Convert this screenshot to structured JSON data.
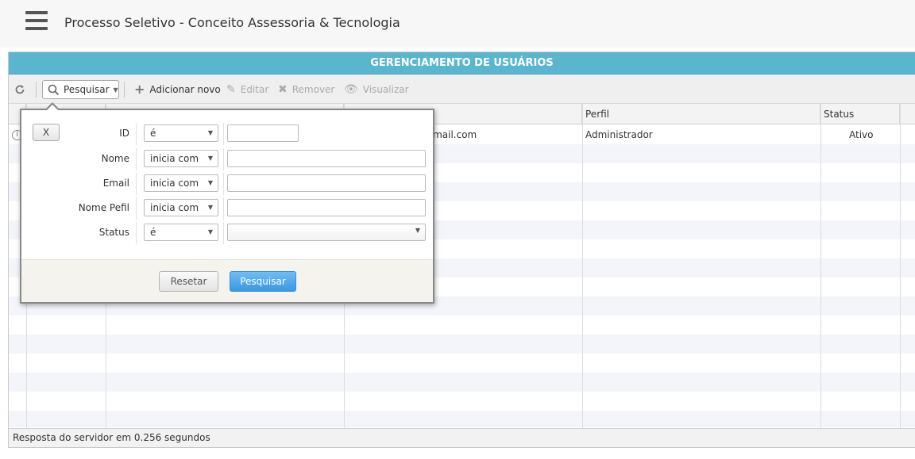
{
  "app": {
    "title": "Processo Seletivo - Conceito Assessoria & Tecnologia"
  },
  "grid": {
    "header": "GERENCIAMENTO DE USUÁRIOS",
    "toolbar": {
      "search_label": "Pesquisar",
      "add_label": "Adicionar novo",
      "edit_label": "Editar",
      "remove_label": "Remover",
      "view_label": "Visualizar"
    },
    "columns": [
      "",
      "",
      "",
      "",
      "Perfil",
      "Status"
    ],
    "rows": [
      {
        "email": "...sousa.silva@hotmail.com",
        "perfil": "Administrador",
        "status": "Ativo"
      }
    ],
    "footer": "Resposta do servidor em 0.256 segundos"
  },
  "search_panel": {
    "close_label": "X",
    "fields": [
      {
        "label": "ID",
        "operator": "é"
      },
      {
        "label": "Nome",
        "operator": "inicia com"
      },
      {
        "label": "Email",
        "operator": "inicia com"
      },
      {
        "label": "Nome Pefil",
        "operator": "inicia com"
      },
      {
        "label": "Status",
        "operator": "é"
      }
    ],
    "reset_label": "Resetar",
    "search_label": "Pesquisar"
  },
  "colors": {
    "header_bg": "#5ab6cf",
    "primary_button": "#3a97e3"
  },
  "icons": [
    "menu-icon",
    "refresh-icon",
    "search-icon",
    "plus-icon",
    "pencil-icon",
    "x-icon",
    "eye-icon",
    "info-icon",
    "chevron-down-icon"
  ]
}
